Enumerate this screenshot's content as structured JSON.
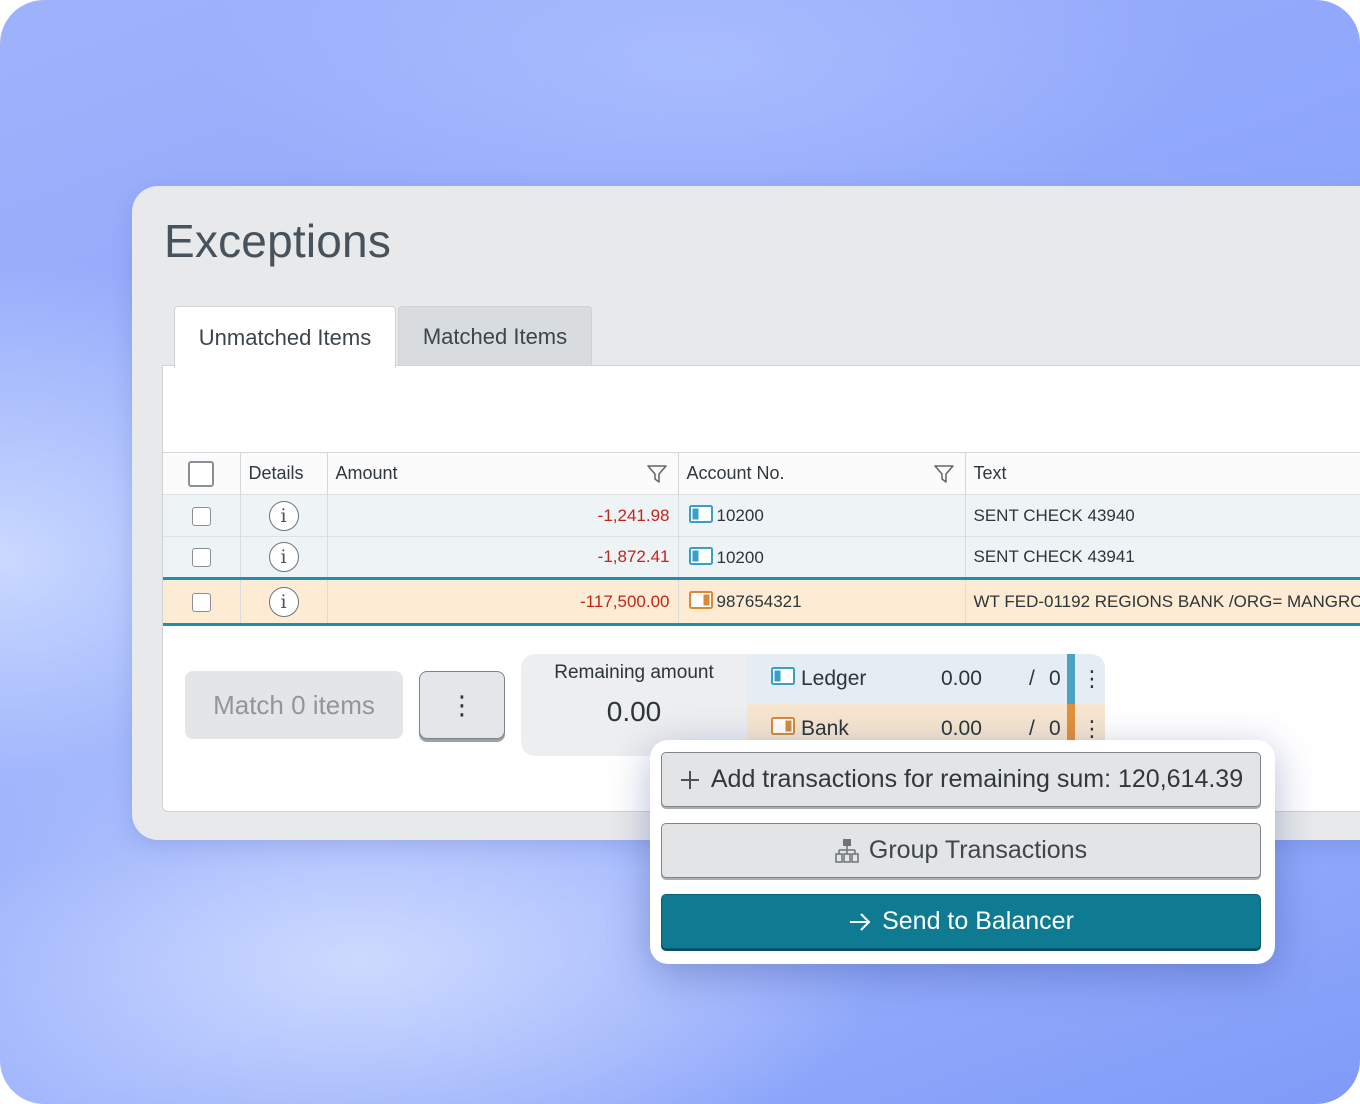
{
  "page": {
    "title": "Exceptions"
  },
  "tabs": [
    {
      "label": "Unmatched Items",
      "active": true
    },
    {
      "label": "Matched Items",
      "active": false
    }
  ],
  "table": {
    "columns": [
      "Details",
      "Amount",
      "Account No.",
      "Text"
    ],
    "rows": [
      {
        "amount": "-1,241.98",
        "account": "10200",
        "account_type": "ledger",
        "text": "SENT CHECK 43940",
        "selected": false
      },
      {
        "amount": "-1,872.41",
        "account": "10200",
        "account_type": "ledger",
        "text": "SENT CHECK 43941",
        "selected": false
      },
      {
        "amount": "-117,500.00",
        "account": "987654321",
        "account_type": "bank",
        "text": "WT FED-01192 REGIONS BANK /ORG= MANGRO",
        "selected": true
      }
    ]
  },
  "footer": {
    "match_label": "Match 0 items",
    "more_glyph": "⋮",
    "remaining_label": "Remaining amount",
    "remaining_value": "0.00",
    "totals": [
      {
        "name": "Ledger",
        "value": "0.00",
        "slash": "/",
        "count": "0",
        "color": "#4aa3c4"
      },
      {
        "name": "Bank",
        "value": "0.00",
        "slash": "/",
        "count": "0",
        "color": "#e0913a"
      }
    ],
    "kebab_glyph": "⋮"
  },
  "popup": {
    "add_label": "Add transactions for remaining sum: 120,614.39",
    "group_label": "Group Transactions",
    "send_label": "Send to Balancer"
  },
  "colors": {
    "ledger": "#3a9fc4",
    "bank": "#d98a36",
    "accent": "#0f7b92",
    "negative": "#c0261c"
  },
  "icons": {
    "info": "i",
    "plus": "+",
    "arrow": "→"
  }
}
